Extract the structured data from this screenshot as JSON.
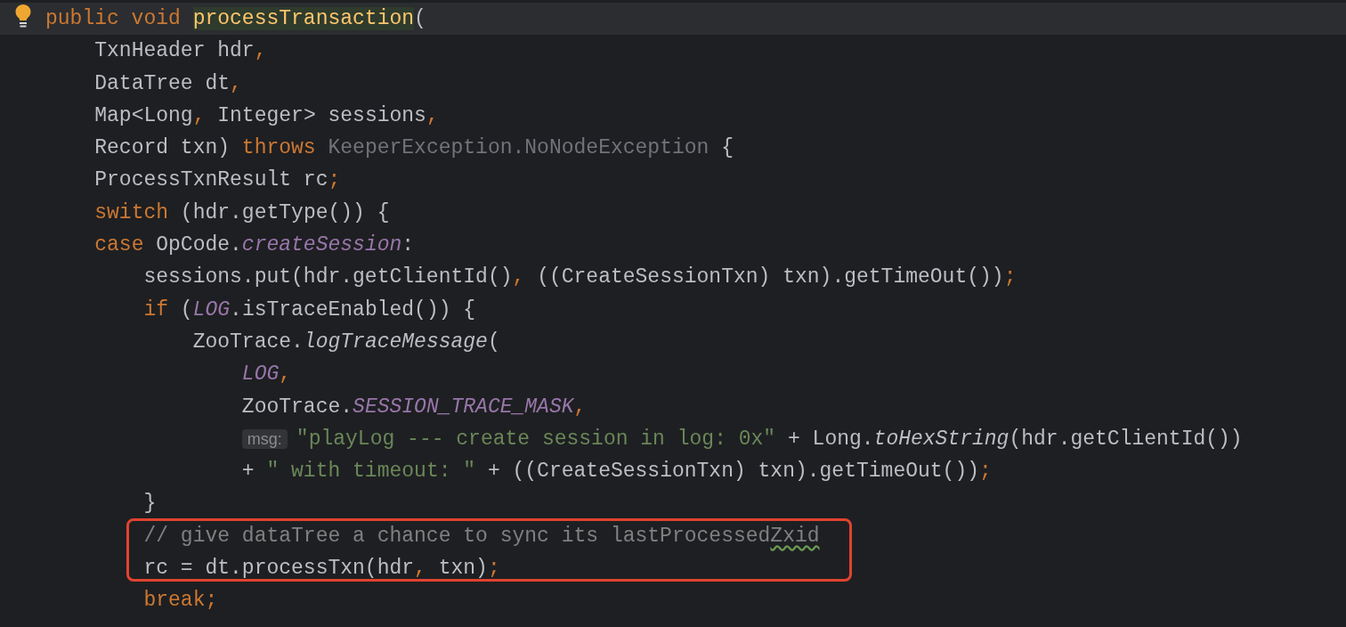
{
  "editor": {
    "lines": [
      {
        "current": true,
        "highlighted": false,
        "tokens": [
          {
            "kind": "keyword",
            "text": "public void "
          },
          {
            "kind": "declaration",
            "text": "processTransaction"
          },
          {
            "kind": "plain",
            "text": "("
          }
        ]
      },
      {
        "current": false,
        "highlighted": false,
        "tokens": [
          {
            "kind": "plain",
            "text": "    TxnHeader hdr"
          },
          {
            "kind": "keyword",
            "text": ","
          }
        ]
      },
      {
        "current": false,
        "highlighted": false,
        "tokens": [
          {
            "kind": "plain",
            "text": "    DataTree dt"
          },
          {
            "kind": "keyword",
            "text": ","
          }
        ]
      },
      {
        "current": false,
        "highlighted": false,
        "tokens": [
          {
            "kind": "plain",
            "text": "    Map<Long"
          },
          {
            "kind": "keyword",
            "text": ","
          },
          {
            "kind": "plain",
            "text": " Integer> sessions"
          },
          {
            "kind": "keyword",
            "text": ","
          }
        ]
      },
      {
        "current": false,
        "highlighted": false,
        "tokens": [
          {
            "kind": "plain",
            "text": "    Record txn) "
          },
          {
            "kind": "keyword",
            "text": "throws "
          },
          {
            "kind": "unused",
            "text": "KeeperException.NoNodeException"
          },
          {
            "kind": "plain",
            "text": " {"
          }
        ]
      },
      {
        "current": false,
        "highlighted": false,
        "tokens": [
          {
            "kind": "plain",
            "text": "    ProcessTxnResult rc"
          },
          {
            "kind": "keyword",
            "text": ";"
          }
        ]
      },
      {
        "current": false,
        "highlighted": false,
        "tokens": [
          {
            "kind": "keyword",
            "text": "    switch"
          },
          {
            "kind": "plain",
            "text": " (hdr.getType()) {"
          }
        ]
      },
      {
        "current": false,
        "highlighted": false,
        "tokens": [
          {
            "kind": "keyword",
            "text": "    case "
          },
          {
            "kind": "plain",
            "text": "OpCode."
          },
          {
            "kind": "static",
            "text": "createSession"
          },
          {
            "kind": "plain",
            "text": ":"
          }
        ]
      },
      {
        "current": false,
        "highlighted": false,
        "tokens": [
          {
            "kind": "plain",
            "text": "        sessions.put(hdr.getClientId()"
          },
          {
            "kind": "keyword",
            "text": ","
          },
          {
            "kind": "plain",
            "text": " ((CreateSessionTxn) txn).getTimeOut())"
          },
          {
            "kind": "keyword",
            "text": ";"
          }
        ]
      },
      {
        "current": false,
        "highlighted": false,
        "tokens": [
          {
            "kind": "keyword",
            "text": "        if"
          },
          {
            "kind": "plain",
            "text": " ("
          },
          {
            "kind": "static",
            "text": "LOG"
          },
          {
            "kind": "plain",
            "text": ".isTraceEnabled()) {"
          }
        ]
      },
      {
        "current": false,
        "highlighted": false,
        "tokens": [
          {
            "kind": "plain",
            "text": "            ZooTrace."
          },
          {
            "kind": "italic",
            "text": "logTraceMessage"
          },
          {
            "kind": "plain",
            "text": "("
          }
        ]
      },
      {
        "current": false,
        "highlighted": false,
        "tokens": [
          {
            "kind": "static",
            "text": "                LOG"
          },
          {
            "kind": "keyword",
            "text": ","
          }
        ]
      },
      {
        "current": false,
        "highlighted": false,
        "tokens": [
          {
            "kind": "plain",
            "text": "                ZooTrace."
          },
          {
            "kind": "static",
            "text": "SESSION_TRACE_MASK"
          },
          {
            "kind": "keyword",
            "text": ","
          }
        ]
      },
      {
        "current": false,
        "highlighted": false,
        "tokens": [
          {
            "kind": "hint",
            "text": "                msg:"
          },
          {
            "kind": "string",
            "text": "\"playLog --- create session in log: 0x\""
          },
          {
            "kind": "plain",
            "text": " + Long."
          },
          {
            "kind": "italic",
            "text": "toHexString"
          },
          {
            "kind": "plain",
            "text": "(hdr.getClientId())"
          }
        ]
      },
      {
        "current": false,
        "highlighted": false,
        "tokens": [
          {
            "kind": "plain",
            "text": "                + "
          },
          {
            "kind": "string",
            "text": "\" with timeout: \""
          },
          {
            "kind": "plain",
            "text": " + ((CreateSessionTxn) txn).getTimeOut())"
          },
          {
            "kind": "keyword",
            "text": ";"
          }
        ]
      },
      {
        "current": false,
        "highlighted": false,
        "tokens": [
          {
            "kind": "plain",
            "text": "        }"
          }
        ]
      },
      {
        "current": false,
        "highlighted": true,
        "tokens": [
          {
            "kind": "comment",
            "text": "        // give dataTree a chance to sync its lastProcessed"
          },
          {
            "kind": "typo",
            "text": "Zxid"
          }
        ]
      },
      {
        "current": false,
        "highlighted": true,
        "tokens": [
          {
            "kind": "plain",
            "text": "        rc = dt.processTxn(hdr"
          },
          {
            "kind": "keyword",
            "text": ","
          },
          {
            "kind": "plain",
            "text": " txn)"
          },
          {
            "kind": "keyword",
            "text": ";"
          }
        ]
      },
      {
        "current": false,
        "highlighted": false,
        "tokens": [
          {
            "kind": "keyword",
            "text": "        break"
          },
          {
            "kind": "keyword",
            "text": ";"
          }
        ]
      }
    ]
  }
}
